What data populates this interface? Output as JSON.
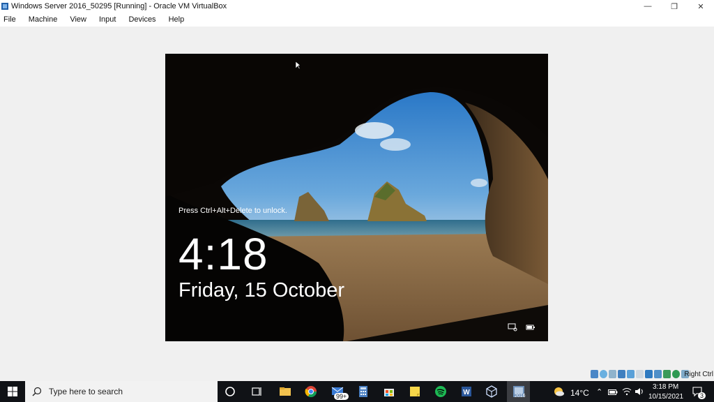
{
  "window": {
    "title": "Windows Server 2016_50295 [Running] - Oracle VM VirtualBox",
    "minimize_glyph": "—",
    "restore_glyph": "❐",
    "close_glyph": "✕"
  },
  "menu": [
    "File",
    "Machine",
    "View",
    "Input",
    "Devices",
    "Help"
  ],
  "lockscreen": {
    "unlock_prompt": "Press Ctrl+Alt+Delete to unlock.",
    "time": "4:18",
    "date": "Friday, 15 October"
  },
  "vbox_status": {
    "host_key": "Right Ctrl",
    "icons": [
      "hard-disk-icon",
      "optical-drive-icon",
      "audio-icon",
      "network-icon",
      "usb-icon",
      "shared-folders-icon",
      "display-icon",
      "video-capture-icon",
      "virtualization-icon",
      "mouse-integration-icon",
      "keyboard-capture-icon"
    ]
  },
  "taskbar": {
    "search_placeholder": "Type here to search",
    "mail_badge": "99+",
    "active_app_label": "2016",
    "weather": "14°C",
    "time": "3:18 PM",
    "date": "10/15/2021",
    "notification_count": "3"
  }
}
